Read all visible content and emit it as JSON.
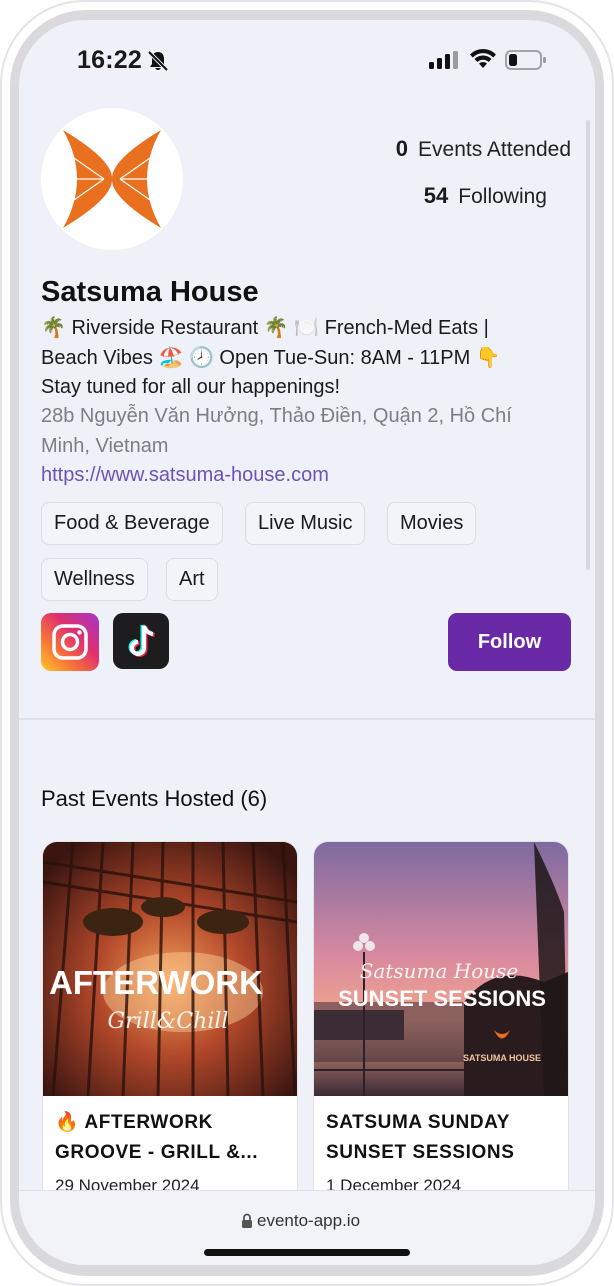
{
  "status_bar": {
    "time": "16:22",
    "icons": [
      "bell-slash-icon",
      "signal-icon",
      "wifi-icon",
      "battery-icon"
    ]
  },
  "profile": {
    "name": "Satsuma House",
    "avatar_icon": "satsuma-logo-icon",
    "stats": [
      {
        "value": "0",
        "label": "Events Attended"
      },
      {
        "value": "54",
        "label": "Following"
      }
    ],
    "bio_lines": [
      "🌴 Riverside Restaurant 🌴 🍽️ French-Med Eats |",
      "Beach Vibes 🏖️ 🕗 Open Tue-Sun: 8AM - 11PM 👇",
      "Stay tuned for all our happenings!"
    ],
    "address_lines": [
      "28b Nguyễn Văn Hưởng, Thảo Điền, Quận 2, Hồ Chí",
      "Minh, Vietnam"
    ],
    "website": "https://www.satsuma-house.com",
    "tags": [
      "Food & Beverage",
      "Live Music",
      "Movies",
      "Wellness",
      "Art"
    ],
    "social_icons": [
      "instagram-icon",
      "tiktok-icon"
    ],
    "follow_label": "Follow"
  },
  "past_events": {
    "title": "Past Events Hosted (6)",
    "events": [
      {
        "title": "🔥 AFTERWORK GROOVE - GRILL &...",
        "date": "29 November 2024",
        "image_text": "AFTERWORK",
        "image_script": "Grill&Chill"
      },
      {
        "title": "SATSUMA SUNDAY SUNSET SESSIONS",
        "date": "1 December 2024",
        "image_script": "Satsuma House",
        "image_text": "SUNSET SESSIONS",
        "image_sign": "SATSUMA HOUSE"
      }
    ]
  },
  "browser": {
    "url": "evento-app.io"
  },
  "colors": {
    "accent": "#6a2aa8",
    "screen_bg": "#eff1f8",
    "link": "#6b54b5",
    "muted": "#7d7d85",
    "logo_orange": "#e8701e"
  }
}
